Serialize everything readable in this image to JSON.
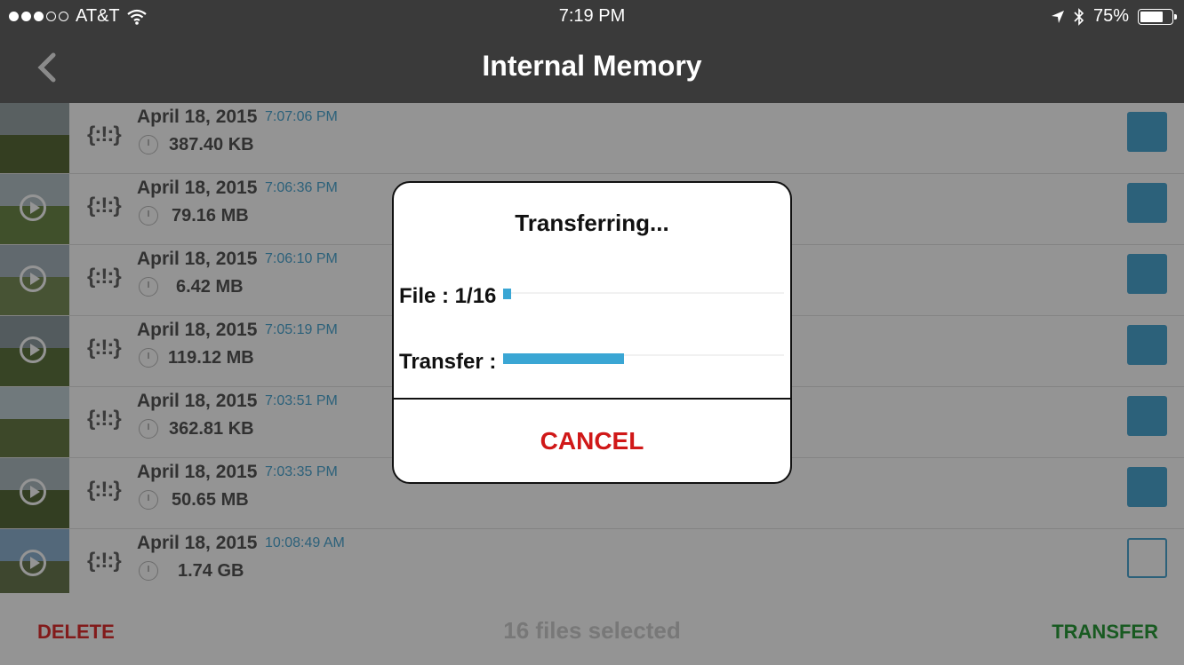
{
  "status_bar": {
    "carrier": "AT&T",
    "signal_bars_filled": 3,
    "signal_bars_total": 5,
    "time": "7:19 PM",
    "battery_percent_label": "75%",
    "battery_level": 0.75,
    "icons": [
      "wifi-icon",
      "location-arrow-icon",
      "bluetooth-icon",
      "battery-icon"
    ]
  },
  "nav": {
    "title": "Internal Memory",
    "back_icon": "chevron-left-icon"
  },
  "sensor_symbol": "{:!:}",
  "files": [
    {
      "date": "April 18, 2015",
      "time": "7:07:06 PM",
      "size": "387.40 KB",
      "type": "photo",
      "selected": true
    },
    {
      "date": "April 18, 2015",
      "time": "7:06:36 PM",
      "size": "79.16 MB",
      "type": "video",
      "selected": true
    },
    {
      "date": "April 18, 2015",
      "time": "7:06:10 PM",
      "size": "6.42 MB",
      "type": "video",
      "selected": true
    },
    {
      "date": "April 18, 2015",
      "time": "7:05:19 PM",
      "size": "119.12 MB",
      "type": "video",
      "selected": true
    },
    {
      "date": "April 18, 2015",
      "time": "7:03:51 PM",
      "size": "362.81 KB",
      "type": "photo",
      "selected": true
    },
    {
      "date": "April 18, 2015",
      "time": "7:03:35 PM",
      "size": "50.65 MB",
      "type": "video",
      "selected": true
    },
    {
      "date": "April 18, 2015",
      "time": "10:08:49 AM",
      "size": "1.74 GB",
      "type": "video",
      "selected": false
    }
  ],
  "bottom_bar": {
    "delete_label": "DELETE",
    "selected_label": "16 files selected",
    "transfer_label": "TRANSFER"
  },
  "dialog": {
    "title": "Transferring...",
    "file_label": "File : 1/16",
    "file_progress": 0.03,
    "transfer_label": "Transfer :",
    "transfer_progress": 0.43,
    "cancel_label": "CANCEL"
  },
  "colors": {
    "accent": "#4da7d3",
    "delete": "#e03030",
    "transfer": "#2a9b3a",
    "cancel": "#d01818",
    "bar_background": "#3a3a3a"
  }
}
